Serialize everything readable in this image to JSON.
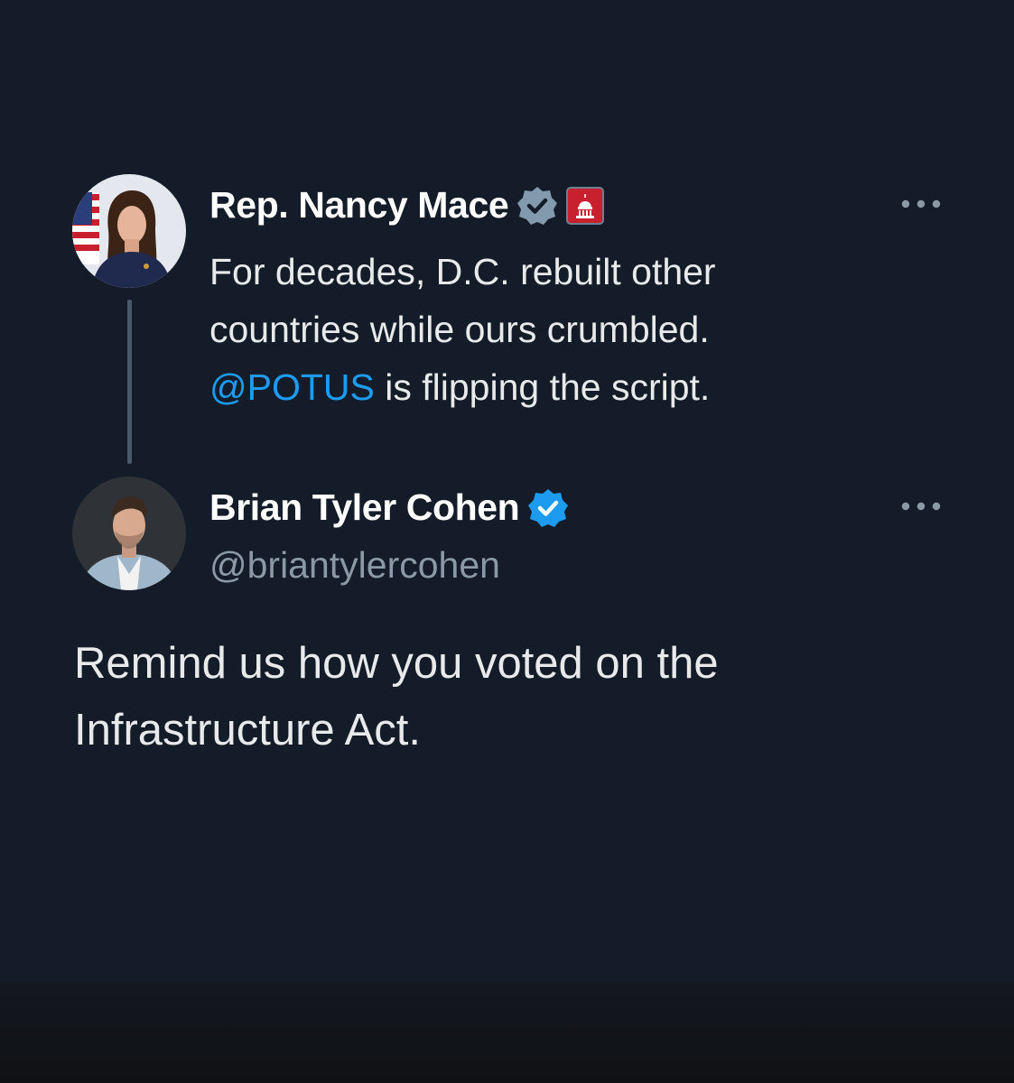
{
  "quoted_tweet": {
    "author_name": "Rep. Nancy Mace",
    "line1": "For decades, D.C. rebuilt other",
    "line2": "countries while ours crumbled.",
    "mention": "@POTUS",
    "line3_rest": " is flipping the script.",
    "avatar_icon": "profile-photo-nancy-mace",
    "verified_icon": "gray-verified-badge",
    "affiliation_icon": "us-house-capitol-badge",
    "more_icon": "more-options-icon"
  },
  "reply_tweet": {
    "author_name": "Brian Tyler Cohen",
    "handle": "@briantylercohen",
    "line1": "Remind us how you voted on the",
    "line2": "Infrastructure Act.",
    "avatar_icon": "profile-photo-brian-tyler-cohen",
    "verified_icon": "blue-verified-badge",
    "more_icon": "more-options-icon"
  },
  "colors": {
    "background": "#151c29",
    "mention": "#1d9bf0",
    "blue_verified": "#1d9bf0",
    "gray_verified": "#829aab",
    "affiliation_badge": "#c8202f",
    "handle": "#8b98a5"
  }
}
